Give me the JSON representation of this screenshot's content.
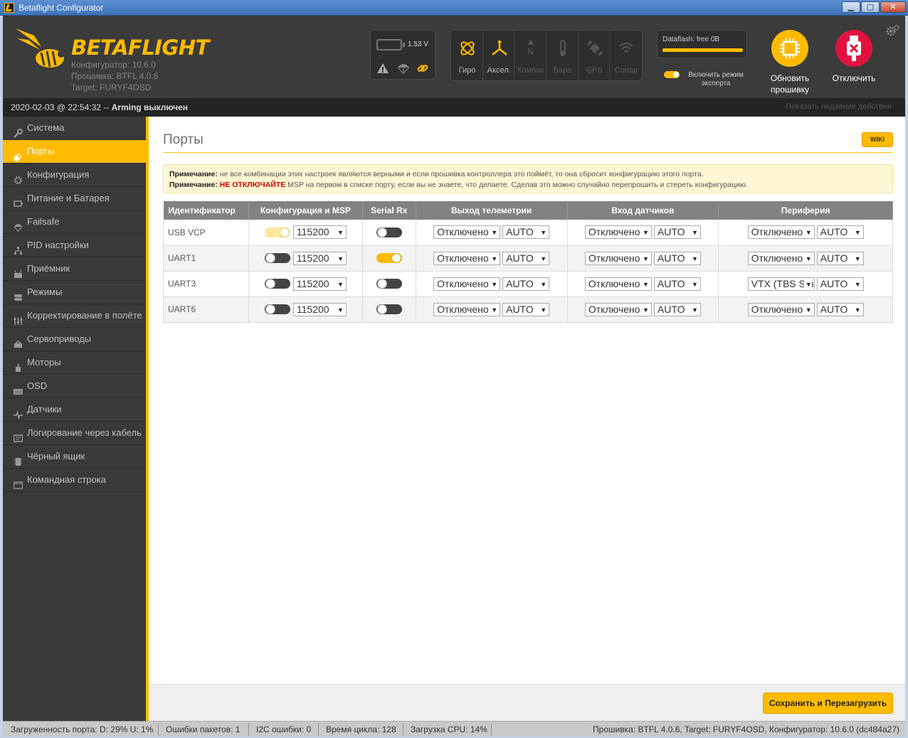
{
  "window": {
    "title": "Betaflight Configurator",
    "min": "▁",
    "max": "□",
    "close": "✕"
  },
  "header": {
    "logo_text": "BETAFLIGHT",
    "configurator_version": "Конфигуратор: 10.6.0",
    "firmware_version": "Прошивка: BTFL 4.0.6",
    "target": "Target: FURYF4OSD",
    "battery_voltage": "1.53 V",
    "sensors": [
      {
        "label": "Гиро",
        "icon": "gyro-icon",
        "active": true
      },
      {
        "label": "Аксел.",
        "icon": "accel-icon",
        "active": true
      },
      {
        "label": "Компас",
        "icon": "compass-icon",
        "active": false
      },
      {
        "label": "Баро",
        "icon": "baro-icon",
        "active": false
      },
      {
        "label": "GPS",
        "icon": "gps-icon",
        "active": false
      },
      {
        "label": "Сонар",
        "icon": "sonar-icon",
        "active": false
      }
    ],
    "dataflash": "Dataflash: free 0B",
    "expert_mode": "Включить режим эксперта",
    "update_firmware": "Обновить прошивку",
    "disconnect": "Отключить"
  },
  "status": {
    "datetime": "2020-02-03 @ 22:54:32 -- ",
    "arming_bold": "Arming",
    "arming_state": " выключен",
    "recent_actions": "Показать недавние действия"
  },
  "sidebar": {
    "items": [
      {
        "label": "Система",
        "icon": "wrench-icon",
        "active": false
      },
      {
        "label": "Порты",
        "icon": "plug-icon",
        "active": true
      },
      {
        "label": "Конфигурация",
        "icon": "gear-icon",
        "active": false
      },
      {
        "label": "Питание и Батарея",
        "icon": "battery-icon",
        "active": false
      },
      {
        "label": "Failsafe",
        "icon": "parachute-icon",
        "active": false
      },
      {
        "label": "PID настройки",
        "icon": "sitemap-icon",
        "active": false
      },
      {
        "label": "Приёмник",
        "icon": "receiver-icon",
        "active": false
      },
      {
        "label": "Режимы",
        "icon": "modes-icon",
        "active": false
      },
      {
        "label": "Корректирование в полёте",
        "icon": "sliders-icon",
        "active": false
      },
      {
        "label": "Сервоприводы",
        "icon": "servo-icon",
        "active": false
      },
      {
        "label": "Моторы",
        "icon": "motor-icon",
        "active": false
      },
      {
        "label": "OSD",
        "icon": "osd-icon",
        "active": false
      },
      {
        "label": "Датчики",
        "icon": "pulse-icon",
        "active": false
      },
      {
        "label": "Логирование через кабель",
        "icon": "logging-icon",
        "active": false
      },
      {
        "label": "Чёрный ящик",
        "icon": "blackbox-icon",
        "active": false
      },
      {
        "label": "Командная строка",
        "icon": "cli-icon",
        "active": false
      }
    ]
  },
  "page": {
    "title": "Порты",
    "wiki": "WIKI",
    "note1_label": "Примечание:",
    "note1_text": " не все комбинации этих настроек являются верными и если прошивка контроллера это поймёт, то она сбросит конфигурацию этого порта.",
    "note2_label": "Примечание:",
    "note2_red": " НЕ ОТКЛЮЧАЙТЕ",
    "note2_text": " MSP на первом в списке порту, если вы не знаете, что делаете. Сделав это можно случайно перепрошить и стереть конфигурацию.",
    "columns": [
      "Идентификатор",
      "Конфигурация и MSP",
      "Serial Rx",
      "Выход телеметрии",
      "Вход датчиков",
      "Периферия"
    ],
    "ports": [
      {
        "id": "USB VCP",
        "msp": "pale",
        "baud": "115200",
        "serial_rx": false,
        "telemetry": "Отключено",
        "telemetry_baud": "AUTO",
        "sensor": "Отключено",
        "sensor_baud": "AUTO",
        "periph": "Отключено",
        "periph_baud": "AUTO"
      },
      {
        "id": "UART1",
        "msp": "off",
        "baud": "115200",
        "serial_rx": true,
        "telemetry": "Отключено",
        "telemetry_baud": "AUTO",
        "sensor": "Отключено",
        "sensor_baud": "AUTO",
        "periph": "Отключено",
        "periph_baud": "AUTO"
      },
      {
        "id": "UART3",
        "msp": "off",
        "baud": "115200",
        "serial_rx": false,
        "telemetry": "Отключено",
        "telemetry_baud": "AUTO",
        "sensor": "Отключено",
        "sensor_baud": "AUTO",
        "periph": "VTX (TBS Smart",
        "periph_baud": "AUTO"
      },
      {
        "id": "UART6",
        "msp": "off",
        "baud": "115200",
        "serial_rx": false,
        "telemetry": "Отключено",
        "telemetry_baud": "AUTO",
        "sensor": "Отключено",
        "sensor_baud": "AUTO",
        "periph": "Отключено",
        "periph_baud": "AUTO"
      }
    ],
    "save_button": "Сохранить и Перезагрузить"
  },
  "footer": {
    "port_load": "Загруженность порта: D: 29% U: 1%",
    "packet_errors": "Ошибки пакетов: 1",
    "i2c_errors": "I2C ошибки: 0",
    "cycle_time": "Время цикла: 128",
    "cpu_load": "Загрузка CPU: 14%",
    "firmware_info": "Прошивка: BTFL 4.0.6, Target: FURYF4OSD, Конфигуратор: 10.6.0 (dc484a27)"
  },
  "colors": {
    "accent": "#ffbb00",
    "sidebar": "#393939",
    "header": "#3b3b3b",
    "danger": "#e2123f"
  }
}
